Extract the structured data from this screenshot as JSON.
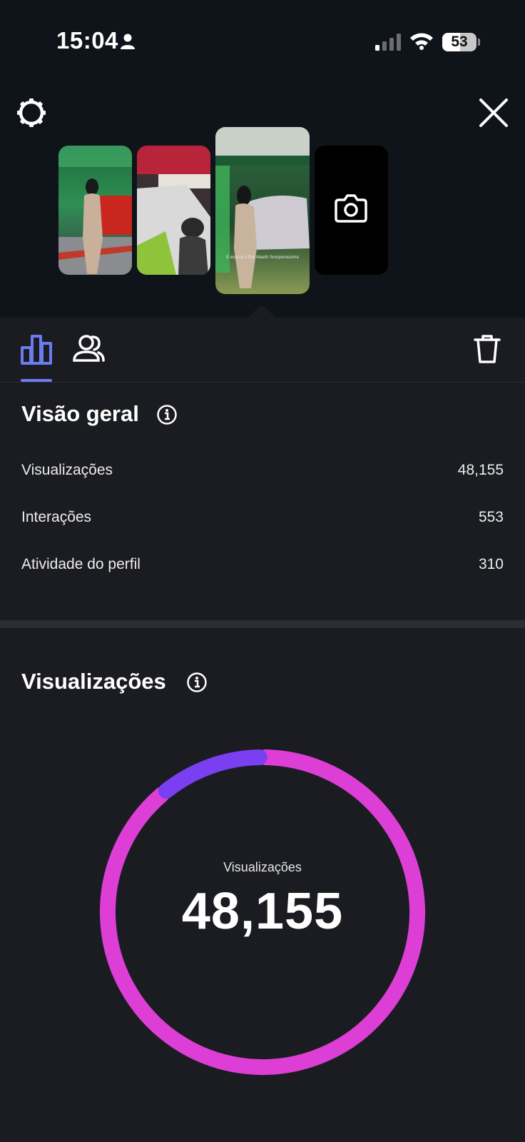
{
  "status_bar": {
    "time": "15:04",
    "battery": "53",
    "battery_level": 0.53
  },
  "header": {
    "settings_icon": "gear-icon",
    "close_icon": "close-icon"
  },
  "thumbnails": [
    {
      "selected": false
    },
    {
      "selected": false
    },
    {
      "selected": true,
      "caption": "E esse é o Fiat Abarth Scorpionissima"
    },
    {
      "icon": "camera-icon"
    }
  ],
  "tabs": {
    "insights_icon": "bar-chart-icon",
    "audience_icon": "people-icon",
    "delete_icon": "trash-icon",
    "active_color": "#6b7cf0"
  },
  "overview": {
    "title": "Visão geral",
    "rows": [
      {
        "label": "Visualizações",
        "value": "48,155"
      },
      {
        "label": "Interações",
        "value": "553"
      },
      {
        "label": "Atividade do perfil",
        "value": "310"
      }
    ]
  },
  "views": {
    "title": "Visualizações",
    "center_label": "Visualizações",
    "center_value": "48,155"
  },
  "chart_data": {
    "type": "pie",
    "style": "donut",
    "series": [
      {
        "color": "#dd3fd6",
        "fraction": 0.89
      },
      {
        "color": "#7b3ff2",
        "fraction": 0.11
      }
    ]
  }
}
